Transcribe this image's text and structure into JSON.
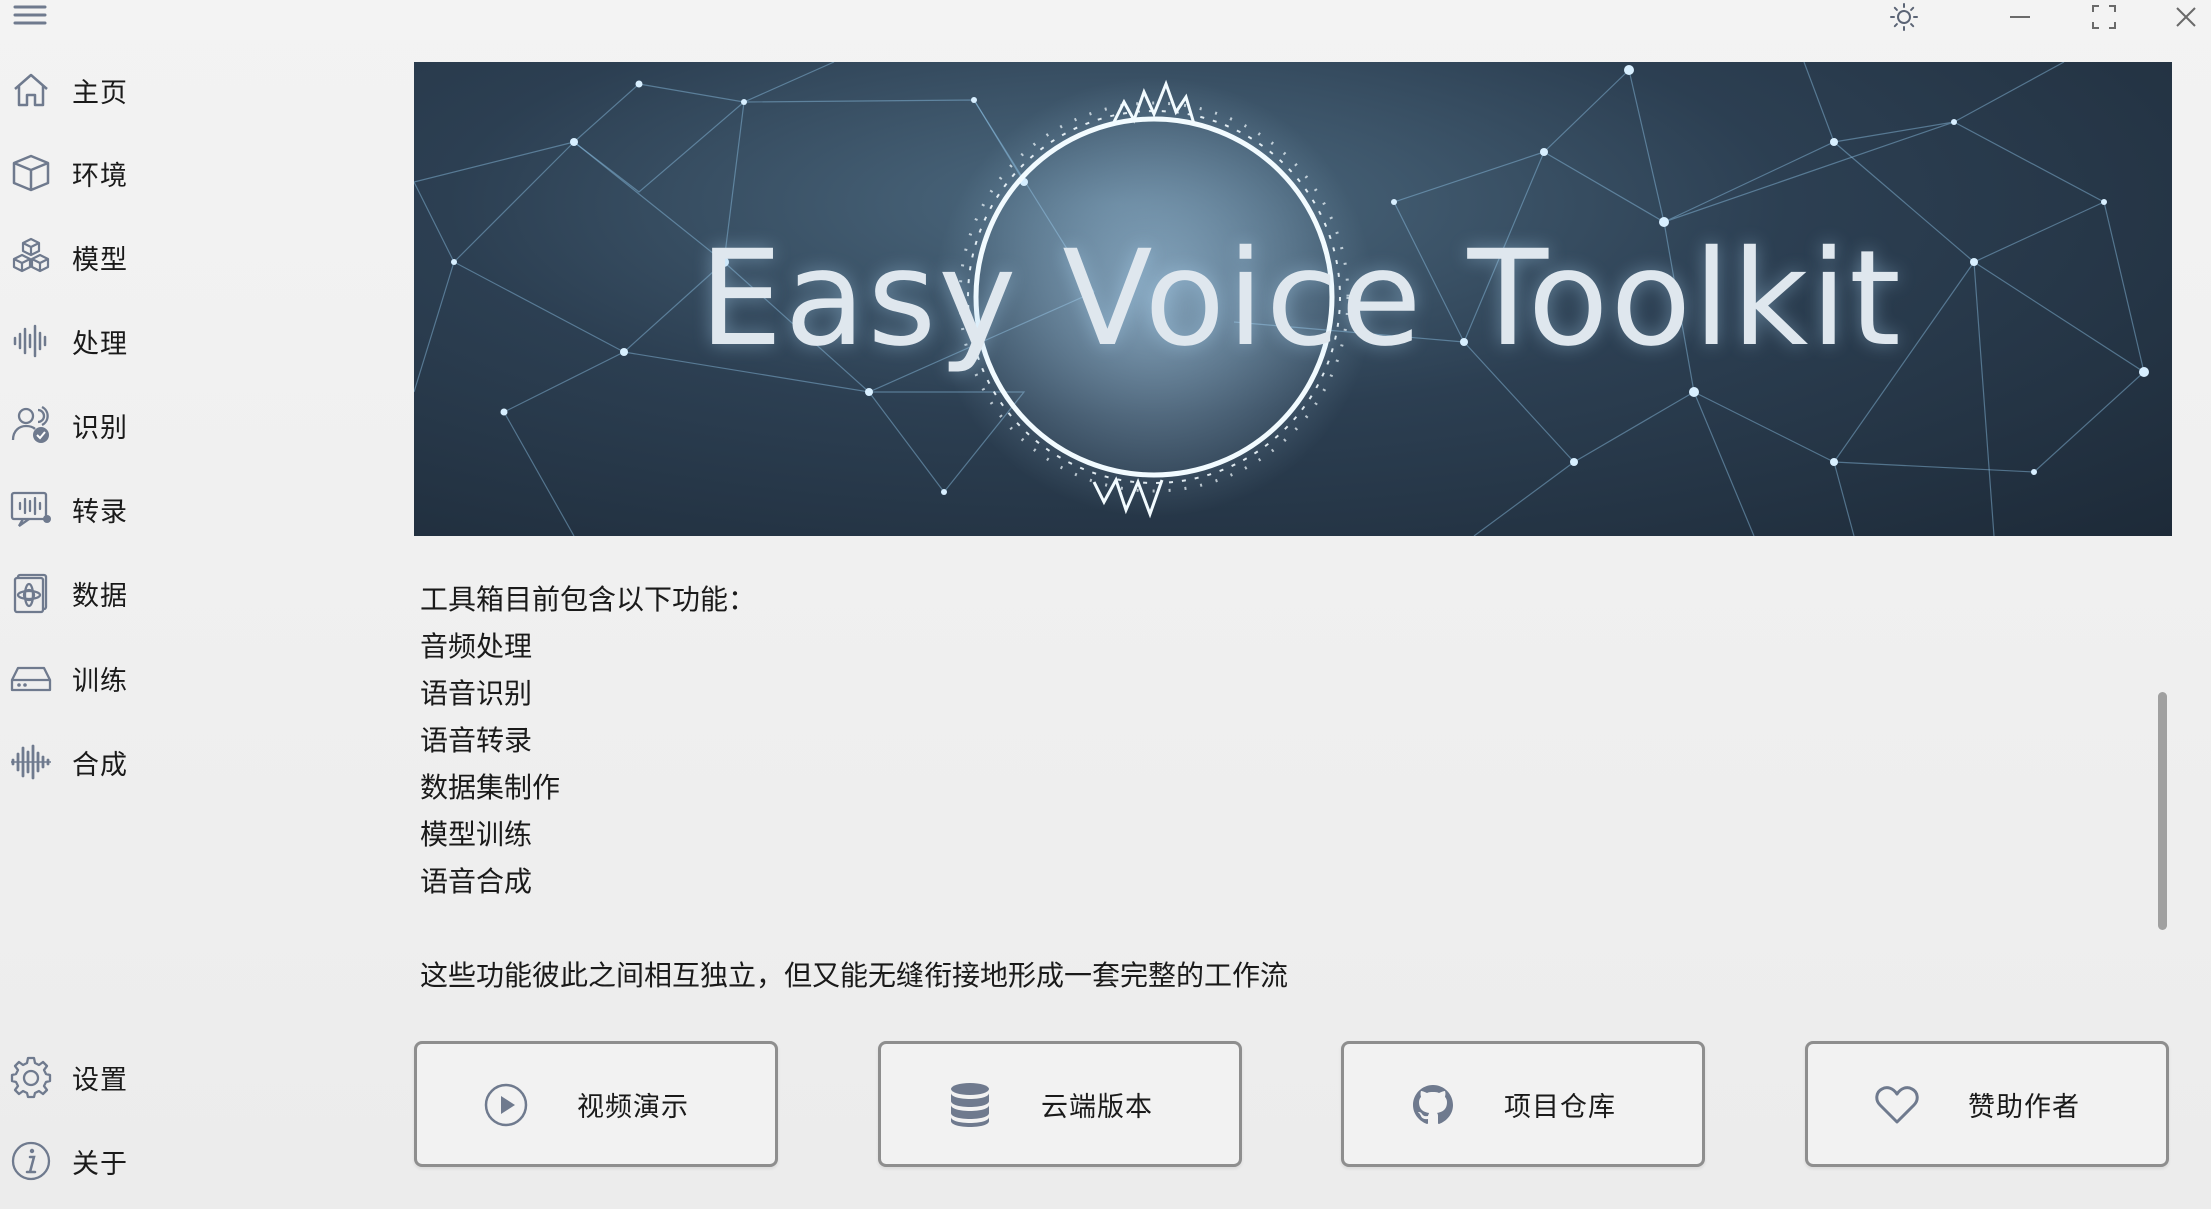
{
  "window": {
    "controls": {
      "theme_icon": "sun-icon",
      "minimize_icon": "minimize-icon",
      "maximize_icon": "maximize-icon",
      "close_icon": "close-icon"
    }
  },
  "sidebar": {
    "toggle_icon": "hamburger-menu-icon",
    "items": [
      {
        "label": "主页",
        "icon": "home-icon"
      },
      {
        "label": "环境",
        "icon": "box-icon"
      },
      {
        "label": "模型",
        "icon": "cubes-icon"
      },
      {
        "label": "处理",
        "icon": "waveform-icon"
      },
      {
        "label": "识别",
        "icon": "user-check-icon"
      },
      {
        "label": "转录",
        "icon": "transcribe-icon"
      },
      {
        "label": "数据",
        "icon": "data-icon"
      },
      {
        "label": "训练",
        "icon": "drive-icon"
      },
      {
        "label": "合成",
        "icon": "synth-icon"
      }
    ],
    "bottom_items": [
      {
        "label": "设置",
        "icon": "gear-icon"
      },
      {
        "label": "关于",
        "icon": "info-icon"
      }
    ]
  },
  "banner": {
    "title": "Easy Voice Toolkit"
  },
  "description": {
    "intro": "工具箱目前包含以下功能：",
    "features": [
      "音频处理",
      "语音识别",
      "语音转录",
      "数据集制作",
      "模型训练",
      "语音合成"
    ],
    "summary": "这些功能彼此之间相互独立，但又能无缝衔接地形成一套完整的工作流"
  },
  "actions": [
    {
      "label": "视频演示",
      "icon": "play-circle-icon"
    },
    {
      "label": "云端版本",
      "icon": "database-icon"
    },
    {
      "label": "项目仓库",
      "icon": "github-icon"
    },
    {
      "label": "赞助作者",
      "icon": "heart-icon"
    }
  ],
  "colors": {
    "background": "#efefef",
    "icon": "#6f7a8e",
    "button_border": "#8e8e8e",
    "banner_dark": "#1d2a38"
  }
}
